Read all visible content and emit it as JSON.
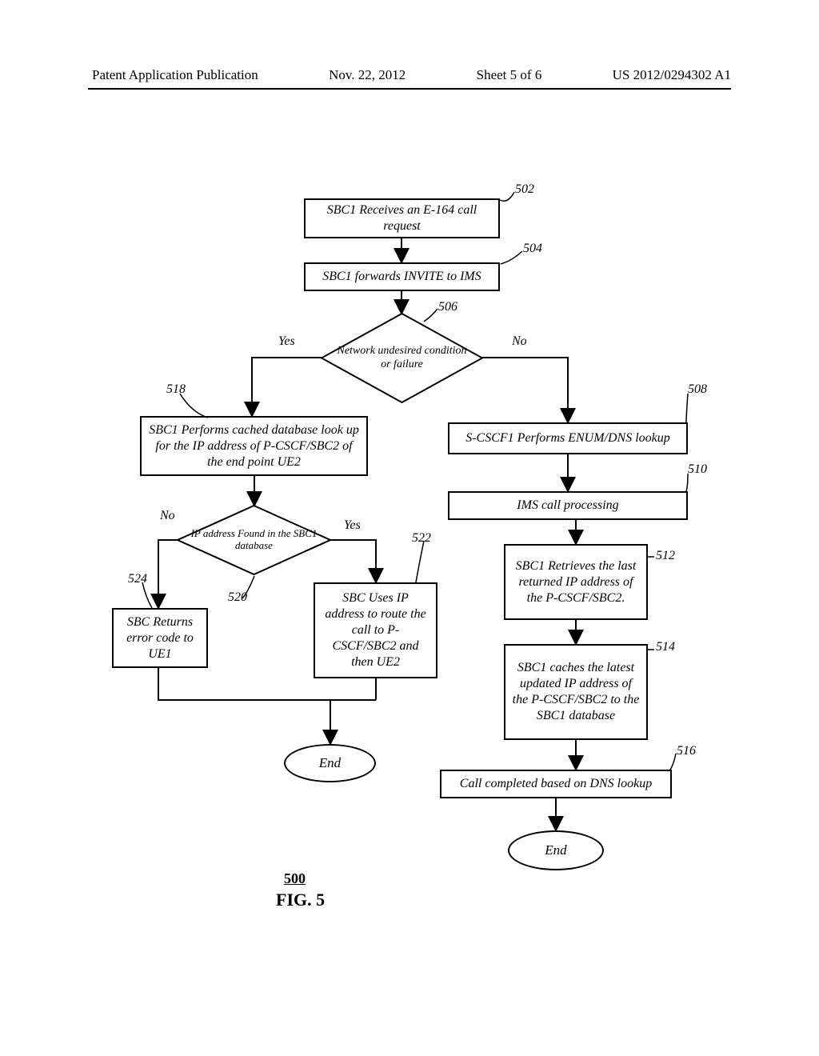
{
  "header": {
    "title": "Patent Application Publication",
    "date": "Nov. 22, 2012",
    "sheet": "Sheet 5 of 6",
    "pubno": "US 2012/0294302 A1"
  },
  "figure": {
    "number_label": "500",
    "caption": "FIG. 5"
  },
  "steps": {
    "s502": {
      "text": "SBC1 Receives an E-164 call request",
      "ref": "502"
    },
    "s504": {
      "text": "SBC1 forwards INVITE to IMS",
      "ref": "504"
    },
    "s506": {
      "text": "Network undesired condition or failure",
      "ref": "506",
      "yes": "Yes",
      "no": "No"
    },
    "s508": {
      "text": "S-CSCF1 Performs ENUM/DNS lookup",
      "ref": "508"
    },
    "s510": {
      "text": "IMS call processing",
      "ref": "510"
    },
    "s512": {
      "text": "SBC1 Retrieves the last returned IP address of the P-CSCF/SBC2.",
      "ref": "512"
    },
    "s514": {
      "text": "SBC1 caches the latest updated IP address of the P-CSCF/SBC2 to the SBC1 database",
      "ref": "514"
    },
    "s516": {
      "text": "Call completed based on DNS lookup",
      "ref": "516"
    },
    "s518": {
      "text": "SBC1 Performs cached  database look up for the IP address of P-CSCF/SBC2 of the end point UE2",
      "ref": "518"
    },
    "s520": {
      "text": "IP address Found in the SBC1 database",
      "ref": "520",
      "yes": "Yes",
      "no": "No"
    },
    "s522": {
      "text": "SBC Uses IP address to route the call to P-CSCF/SBC2  and then UE2",
      "ref": "522"
    },
    "s524": {
      "text": "SBC Returns error code to UE1",
      "ref": "524"
    },
    "end1": {
      "text": "End"
    },
    "end2": {
      "text": "End"
    }
  }
}
